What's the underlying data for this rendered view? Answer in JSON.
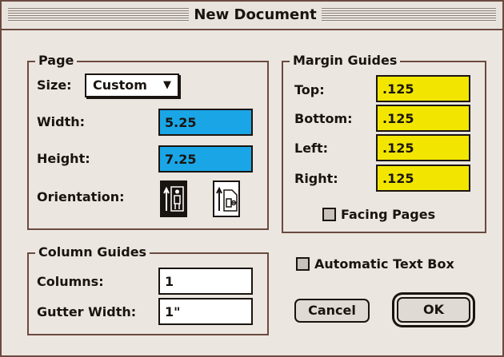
{
  "window": {
    "title": "New Document"
  },
  "page": {
    "legend": "Page",
    "size_label": "Size:",
    "size_value": "Custom",
    "width_label": "Width:",
    "width_value": "5.25",
    "height_label": "Height:",
    "height_value": "7.25",
    "orientation_label": "Orientation:",
    "orientation_options": [
      "portrait",
      "landscape"
    ],
    "orientation_selected": "portrait"
  },
  "margin_guides": {
    "legend": "Margin Guides",
    "top_label": "Top:",
    "top_value": ".125",
    "bottom_label": "Bottom:",
    "bottom_value": ".125",
    "left_label": "Left:",
    "left_value": ".125",
    "right_label": "Right:",
    "right_value": ".125",
    "facing_pages_label": "Facing Pages",
    "facing_pages_checked": false
  },
  "column_guides": {
    "legend": "Column Guides",
    "columns_label": "Columns:",
    "columns_value": "1",
    "gutter_label": "Gutter Width:",
    "gutter_value": "1\""
  },
  "automatic_text_box": {
    "label": "Automatic Text Box",
    "checked": false
  },
  "buttons": {
    "cancel": "Cancel",
    "ok": "OK"
  },
  "colors": {
    "width_height_fields": "#1aa6e6",
    "margin_fields": "#f2e600",
    "frame": "#6b4a40"
  },
  "icons": {
    "popup_arrow": "triangle-down-icon",
    "portrait": "portrait-person-icon",
    "landscape": "landscape-person-icon"
  }
}
